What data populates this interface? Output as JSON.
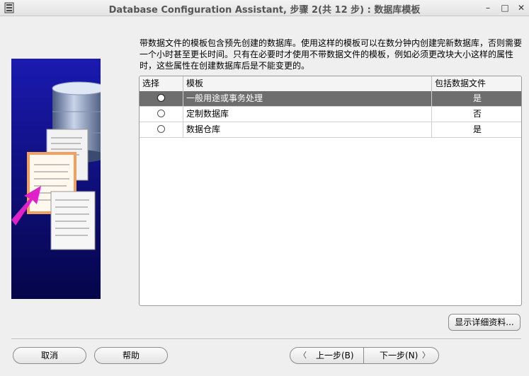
{
  "window": {
    "title": "Database Configuration Assistant, 步骤 2(共 12 步) : 数据库模板",
    "minimize_glyph": "–",
    "maximize_glyph": "□",
    "close_glyph": "✕"
  },
  "description": {
    "line1": "带数据文件的模板包含预先创建的数据库。使用这样的模板可以在数分钟内创建完新数据库，否则需要",
    "line2": "一个小时甚至更长时间。只有在必要时才使用不带数据文件的模板，例如必须更改块大小这样的属性",
    "line3": "时，这些属性在创建数据库后是不能变更的。"
  },
  "table": {
    "headers": {
      "select": "选择",
      "template": "模板",
      "includes_datafiles": "包括数据文件"
    },
    "rows": [
      {
        "template": "一般用途或事务处理",
        "includes": "是",
        "selected": true
      },
      {
        "template": "定制数据库",
        "includes": "否",
        "selected": false
      },
      {
        "template": "数据仓库",
        "includes": "是",
        "selected": false
      }
    ]
  },
  "buttons": {
    "details": "显示详细资料...",
    "cancel": "取消",
    "help": "帮助",
    "back": "上一步(B)",
    "next": "下一步(N)",
    "back_chevron": "〈",
    "next_chevron": "〉"
  },
  "colors": {
    "graphic_blue": "#0a0a8c",
    "selected_row": "#6e6e6e",
    "arrow_magenta": "#e020c8"
  }
}
